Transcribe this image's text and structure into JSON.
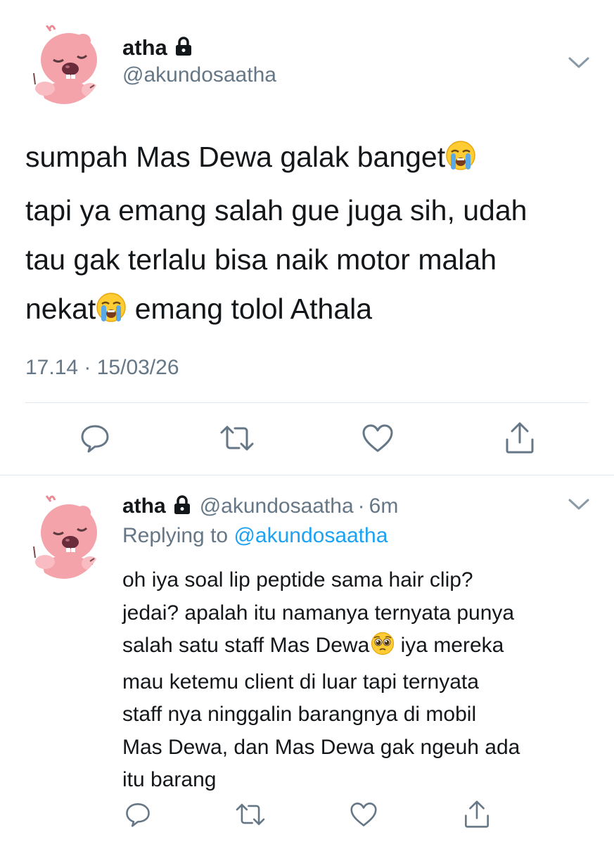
{
  "main_tweet": {
    "author": {
      "display_name": "atha",
      "handle": "@akundosaatha",
      "avatar_icon": "pink-beaver-avatar",
      "protected_icon": "lock-icon"
    },
    "text_lines": [
      {
        "before": "sumpah Mas Dewa galak banget",
        "emoji": "loudly-crying-face",
        "after": ""
      },
      {
        "before": "tapi ya emang salah gue juga sih, udah",
        "emoji": null,
        "after": ""
      },
      {
        "before": "tau gak terlalu bisa naik motor malah",
        "emoji": null,
        "after": ""
      },
      {
        "before": "nekat",
        "emoji": "loudly-crying-face",
        "after": " emang tolol Athala"
      }
    ],
    "timestamp": "17.14 · 15/03/26",
    "actions": [
      "reply-icon",
      "retweet-icon",
      "like-icon",
      "share-icon"
    ]
  },
  "reply_tweet": {
    "author": {
      "display_name": "atha",
      "handle": "@akundosaatha",
      "separator": "·",
      "time_ago": "6m",
      "avatar_icon": "pink-beaver-avatar",
      "protected_icon": "lock-icon"
    },
    "replying_to_label": "Replying to",
    "replying_to_handle": "@akundosaatha",
    "text_lines": [
      {
        "before": "oh iya soal lip peptide sama hair clip?",
        "emoji": null,
        "after": ""
      },
      {
        "before": "jedai? apalah itu namanya ternyata punya",
        "emoji": null,
        "after": ""
      },
      {
        "before": "salah satu staff Mas Dewa",
        "emoji": "pleading-face",
        "after": " iya mereka"
      },
      {
        "before": "mau ketemu client di luar tapi ternyata",
        "emoji": null,
        "after": ""
      },
      {
        "before": "staff nya ninggalin barangnya di mobil",
        "emoji": null,
        "after": ""
      },
      {
        "before": "Mas Dewa, dan Mas Dewa gak ngeuh ada",
        "emoji": null,
        "after": ""
      },
      {
        "before": "itu barang",
        "emoji": null,
        "after": ""
      }
    ],
    "actions": [
      "reply-icon",
      "retweet-icon",
      "like-icon",
      "share-icon"
    ]
  },
  "colors": {
    "text_primary": "#14171a",
    "text_secondary": "#657786",
    "link": "#1da1f2",
    "divider": "#e1e8ed",
    "icon": "#657786",
    "avatar_pink": "#f4a3ab"
  }
}
